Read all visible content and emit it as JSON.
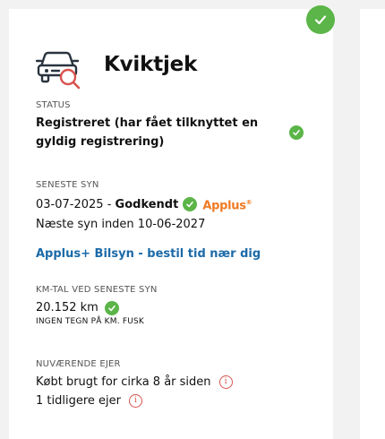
{
  "header": {
    "title": "Kviktjek",
    "icon": "car-search-icon"
  },
  "status": {
    "label": "STATUS",
    "value": "Registreret (har fået tilknyttet en gyldig registrering)"
  },
  "inspection": {
    "label": "SENESTE SYN",
    "date": "03-07-2025",
    "separator": " - ",
    "result": "Godkendt",
    "provider_logo": "Applus",
    "provider_sup": "®",
    "next": "Næste syn inden 10-06-2027",
    "link": "Applus+ Bilsyn - bestil tid nær dig"
  },
  "mileage": {
    "label": "KM-TAL VED SENESTE SYN",
    "value": "20.152 km",
    "note": "INGEN TEGN PÅ KM. FUSK"
  },
  "owner": {
    "label": "NUVÆRENDE EJER",
    "bought": "Købt brugt for cirka 8 år siden",
    "previous": "1 tidligere ejer"
  },
  "colors": {
    "green": "#5bb548",
    "blue": "#1b6aa8",
    "orange": "#f07a24",
    "red": "#d9534f"
  }
}
